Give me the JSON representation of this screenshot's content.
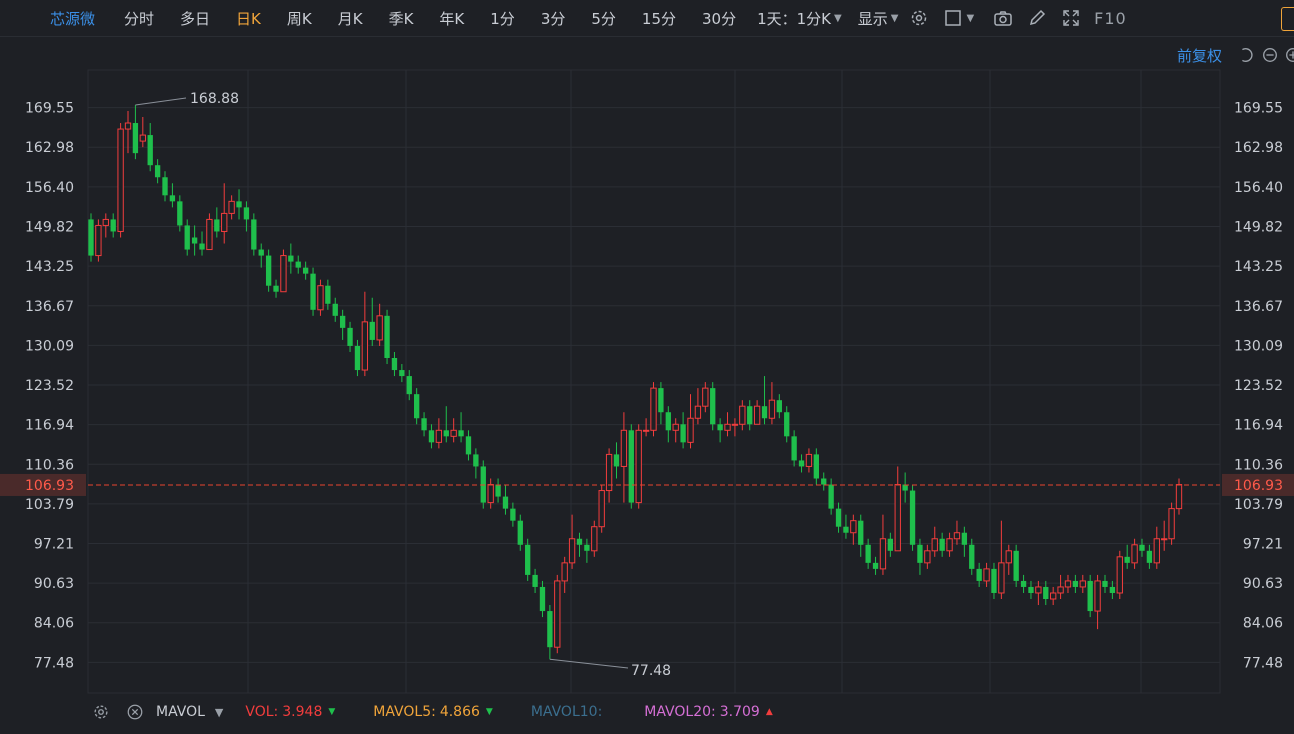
{
  "toolbar": {
    "stock_name": "芯源微",
    "tabs": [
      {
        "label": "分时",
        "active": false
      },
      {
        "label": "多日",
        "active": false
      },
      {
        "label": "日K",
        "active": true
      },
      {
        "label": "周K",
        "active": false
      },
      {
        "label": "月K",
        "active": false
      },
      {
        "label": "季K",
        "active": false
      },
      {
        "label": "年K",
        "active": false
      },
      {
        "label": "1分",
        "active": false
      },
      {
        "label": "3分",
        "active": false
      },
      {
        "label": "5分",
        "active": false
      },
      {
        "label": "15分",
        "active": false
      },
      {
        "label": "30分",
        "active": false
      }
    ],
    "period_select": "1天：1分K",
    "display_select": "显示",
    "f10_label": "F10",
    "icons": [
      "gear-icon",
      "checkbox-icon",
      "camera-icon",
      "pencil-icon",
      "fullscreen-icon"
    ]
  },
  "subbar": {
    "adjust_label": "前复权"
  },
  "colors": {
    "up": "#f23d3d",
    "down": "#1fbf4c",
    "current": "#e8432f",
    "grid": "#2b2e35",
    "text": "#c9cdd4"
  },
  "chart_data": {
    "type": "candlestick",
    "y_ticks": [
      "169.55",
      "162.98",
      "156.40",
      "149.82",
      "143.25",
      "136.67",
      "130.09",
      "123.52",
      "116.94",
      "110.36",
      "103.79",
      "97.21",
      "90.63",
      "84.06",
      "77.48"
    ],
    "ylim": [
      72.4,
      175.8
    ],
    "current_price": "106.93",
    "max_label": "168.88",
    "min_label": "77.48",
    "grid": true,
    "candles": [
      [
        151,
        145,
        152,
        144
      ],
      [
        145,
        150,
        151,
        144
      ],
      [
        150,
        151,
        152,
        148
      ],
      [
        151,
        149,
        152,
        148
      ],
      [
        149,
        166,
        167,
        148
      ],
      [
        166,
        167,
        169,
        162
      ],
      [
        167,
        162,
        170,
        161
      ],
      [
        164,
        165,
        168,
        163
      ],
      [
        165,
        160,
        167,
        159
      ],
      [
        160,
        158,
        161,
        157
      ],
      [
        158,
        155,
        159,
        154
      ],
      [
        155,
        154,
        157,
        153
      ],
      [
        154,
        150,
        155,
        149
      ],
      [
        150,
        146,
        151,
        145
      ],
      [
        148,
        147,
        150,
        145
      ],
      [
        147,
        146,
        149,
        145
      ],
      [
        146,
        151,
        152,
        146
      ],
      [
        151,
        149,
        153,
        148
      ],
      [
        149,
        152,
        157,
        147
      ],
      [
        152,
        154,
        155,
        151
      ],
      [
        154,
        153,
        156,
        151
      ],
      [
        153,
        151,
        154,
        149
      ],
      [
        151,
        146,
        152,
        145
      ],
      [
        146,
        145,
        147,
        143
      ],
      [
        145,
        140,
        146,
        139
      ],
      [
        140,
        139,
        141,
        138
      ],
      [
        139,
        145,
        146,
        139
      ],
      [
        145,
        144,
        147,
        142
      ],
      [
        144,
        143,
        145,
        142
      ],
      [
        143,
        142,
        144,
        141
      ],
      [
        142,
        136,
        143,
        135
      ],
      [
        136,
        140,
        141,
        135
      ],
      [
        140,
        137,
        141,
        136
      ],
      [
        137,
        135,
        138,
        134
      ],
      [
        135,
        133,
        136,
        131
      ],
      [
        133,
        130,
        134,
        129
      ],
      [
        130,
        126,
        131,
        125
      ],
      [
        126,
        134,
        139,
        125
      ],
      [
        134,
        131,
        138,
        130
      ],
      [
        131,
        135,
        137,
        130
      ],
      [
        135,
        128,
        136,
        127
      ],
      [
        128,
        126,
        129,
        125
      ],
      [
        126,
        125,
        127,
        124
      ],
      [
        125,
        122,
        126,
        121
      ],
      [
        122,
        118,
        123,
        117
      ],
      [
        118,
        116,
        119,
        115
      ],
      [
        116,
        114,
        117,
        113
      ],
      [
        114,
        116,
        118,
        113
      ],
      [
        116,
        115,
        120,
        114
      ],
      [
        115,
        116,
        118,
        114
      ],
      [
        116,
        115,
        119,
        114
      ],
      [
        115,
        112,
        116,
        111
      ],
      [
        112,
        110,
        113,
        108
      ],
      [
        110,
        104,
        111,
        103
      ],
      [
        104,
        107,
        108,
        103
      ],
      [
        107,
        105,
        108,
        104
      ],
      [
        105,
        103,
        107,
        102
      ],
      [
        103,
        101,
        104,
        100
      ],
      [
        101,
        97,
        102,
        96
      ],
      [
        97,
        92,
        98,
        91
      ],
      [
        92,
        90,
        93,
        89
      ],
      [
        90,
        86,
        91,
        85
      ],
      [
        86,
        80,
        87,
        78
      ],
      [
        80,
        91,
        92,
        79
      ],
      [
        91,
        94,
        95,
        89
      ],
      [
        94,
        98,
        102,
        93
      ],
      [
        98,
        97,
        99,
        95
      ],
      [
        97,
        96,
        98,
        94
      ],
      [
        96,
        100,
        101,
        95
      ],
      [
        100,
        106,
        107,
        99
      ],
      [
        106,
        112,
        113,
        104
      ],
      [
        112,
        110,
        114,
        108
      ],
      [
        110,
        116,
        119,
        104
      ],
      [
        116,
        104,
        117,
        103
      ],
      [
        104,
        116,
        117,
        103
      ],
      [
        116,
        116,
        118,
        115
      ],
      [
        116,
        123,
        124,
        115
      ],
      [
        123,
        119,
        124,
        117
      ],
      [
        119,
        116,
        120,
        114
      ],
      [
        116,
        117,
        118,
        114
      ],
      [
        117,
        114,
        119,
        113
      ],
      [
        114,
        118,
        122,
        113
      ],
      [
        118,
        120,
        123,
        117
      ],
      [
        120,
        123,
        124,
        119
      ],
      [
        123,
        117,
        124,
        116
      ],
      [
        117,
        116,
        118,
        114
      ],
      [
        116,
        117,
        119,
        115
      ],
      [
        117,
        117,
        118,
        115
      ],
      [
        117,
        120,
        121,
        116
      ],
      [
        120,
        117,
        121,
        116
      ],
      [
        117,
        120,
        121,
        119
      ],
      [
        120,
        118,
        125,
        117
      ],
      [
        118,
        121,
        124,
        117
      ],
      [
        121,
        119,
        122,
        118
      ],
      [
        119,
        115,
        120,
        114
      ],
      [
        115,
        111,
        116,
        110
      ],
      [
        111,
        110,
        112,
        109
      ],
      [
        110,
        112,
        113,
        109
      ],
      [
        112,
        108,
        113,
        107
      ],
      [
        108,
        107,
        109,
        106
      ],
      [
        107,
        103,
        108,
        102
      ],
      [
        103,
        100,
        104,
        99
      ],
      [
        100,
        99,
        102,
        98
      ],
      [
        99,
        101,
        102,
        97
      ],
      [
        101,
        97,
        102,
        95
      ],
      [
        97,
        94,
        98,
        93
      ],
      [
        94,
        93,
        95,
        92
      ],
      [
        93,
        98,
        102,
        92
      ],
      [
        98,
        96,
        99,
        95
      ],
      [
        96,
        107,
        110,
        96
      ],
      [
        107,
        106,
        109,
        104
      ],
      [
        106,
        97,
        107,
        96
      ],
      [
        97,
        94,
        98,
        92
      ],
      [
        94,
        96,
        97,
        93
      ],
      [
        96,
        98,
        100,
        95
      ],
      [
        98,
        96,
        99,
        95
      ],
      [
        96,
        98,
        99,
        95
      ],
      [
        98,
        99,
        101,
        97
      ],
      [
        99,
        97,
        100,
        95
      ],
      [
        97,
        93,
        98,
        92
      ],
      [
        93,
        91,
        94,
        90
      ],
      [
        91,
        93,
        94,
        90
      ],
      [
        93,
        89,
        94,
        88
      ],
      [
        89,
        94,
        101,
        88
      ],
      [
        94,
        96,
        97,
        92
      ],
      [
        96,
        91,
        97,
        90
      ],
      [
        91,
        90,
        92,
        89
      ],
      [
        90,
        89,
        91,
        88
      ],
      [
        89,
        90,
        91,
        87
      ],
      [
        90,
        88,
        91,
        87
      ],
      [
        88,
        89,
        90,
        87
      ],
      [
        89,
        90,
        92,
        88
      ],
      [
        90,
        91,
        92,
        89
      ],
      [
        91,
        90,
        92,
        89
      ],
      [
        90,
        91,
        92,
        89
      ],
      [
        91,
        86,
        92,
        85
      ],
      [
        86,
        91,
        92,
        83
      ],
      [
        91,
        90,
        92,
        89
      ],
      [
        90,
        89,
        91,
        88
      ],
      [
        89,
        95,
        96,
        88
      ],
      [
        95,
        94,
        97,
        93
      ],
      [
        94,
        97,
        98,
        93
      ],
      [
        97,
        96,
        98,
        95
      ],
      [
        96,
        94,
        97,
        93
      ],
      [
        94,
        98,
        100,
        93
      ],
      [
        98,
        98,
        101,
        96
      ],
      [
        98,
        103,
        104,
        97
      ],
      [
        103,
        107,
        108,
        102
      ]
    ]
  },
  "volume_bar": {
    "indicator": "MAVOL",
    "items": [
      {
        "label": "VOL:",
        "value": "3.948",
        "color": "#f23d3d",
        "trend": "down"
      },
      {
        "label": "MAVOL5:",
        "value": "4.866",
        "color": "#f0a43a",
        "trend": "down"
      },
      {
        "label": "MAVOL10:",
        "value": "",
        "color": "#3b6f8f",
        "trend": ""
      },
      {
        "label": "MAVOL20:",
        "value": "3.709",
        "color": "#d56fd5",
        "trend": "up"
      }
    ]
  }
}
